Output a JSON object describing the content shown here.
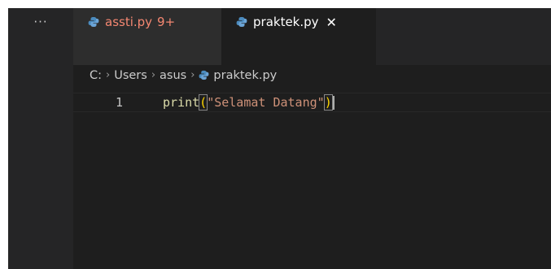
{
  "sidebar": {
    "more_label": "···"
  },
  "tabs": [
    {
      "label": "assti.py",
      "badge": "9+",
      "icon": "python-icon"
    },
    {
      "label": "praktek.py",
      "close": "✕",
      "icon": "python-icon"
    }
  ],
  "breadcrumb": {
    "drive": "C:",
    "seg1": "Users",
    "seg2": "asus",
    "file": "praktek.py",
    "separator": "›"
  },
  "editor": {
    "line_number": "1",
    "code": {
      "fn": "print",
      "open": "(",
      "string": "\"Selamat Datang\"",
      "close": ")"
    }
  },
  "colors": {
    "background": "#1e1e1e",
    "tabbar": "#252526",
    "error_tab_text": "#f48771",
    "function": "#dcdcaa",
    "string": "#ce9178",
    "bracket": "#ffd700"
  }
}
